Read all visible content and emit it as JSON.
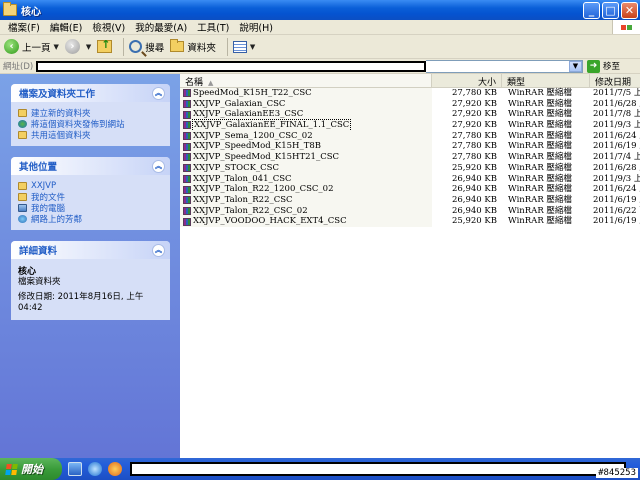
{
  "window": {
    "title": "核心"
  },
  "menu": {
    "items": [
      "檔案(F)",
      "編輯(E)",
      "檢視(V)",
      "我的最愛(A)",
      "工具(T)",
      "說明(H)"
    ]
  },
  "toolbar": {
    "back": "上一頁",
    "search": "搜尋",
    "folders": "資料夾"
  },
  "address": {
    "label": "網址(D)",
    "go": "移至"
  },
  "left": {
    "tasks": {
      "title": "檔案及資料夾工作",
      "links": [
        "建立新的資料夾",
        "將這個資料夾發佈到網站",
        "共用這個資料夾"
      ]
    },
    "places": {
      "title": "其他位置",
      "links": [
        "XXJVP",
        "我的文件",
        "我的電腦",
        "網路上的芳鄰"
      ]
    },
    "details": {
      "title": "詳細資料",
      "name": "核心",
      "kind": "檔案資料夾",
      "modified": "修改日期: 2011年8月16日, 上午 04:42"
    }
  },
  "list": {
    "columns": {
      "name": "名稱",
      "size": "大小",
      "type": "類型",
      "date": "修改日期"
    },
    "files": [
      {
        "name": "SpeedMod_K15H_T22_CSC",
        "size": "27,780 KB",
        "type": "WinRAR 壓縮檔",
        "date": "2011/7/5 上午"
      },
      {
        "name": "XXJVP_Galaxian_CSC",
        "size": "27,920 KB",
        "type": "WinRAR 壓縮檔",
        "date": "2011/6/28 上午"
      },
      {
        "name": "XXJVP_GalaxianEE3_CSC",
        "size": "27,920 KB",
        "type": "WinRAR 壓縮檔",
        "date": "2011/7/8 上午"
      },
      {
        "name": "XXJVP_GalaxianEE_FINAL_1.1_CSC",
        "size": "27,920 KB",
        "type": "WinRAR 壓縮檔",
        "date": "2011/9/3 上午"
      },
      {
        "name": "XXJVP_Sema_1200_CSC_02",
        "size": "27,780 KB",
        "type": "WinRAR 壓縮檔",
        "date": "2011/6/24 上午"
      },
      {
        "name": "XXJVP_SpeedMod_K15H_T8B",
        "size": "27,780 KB",
        "type": "WinRAR 壓縮檔",
        "date": "2011/6/19 上午"
      },
      {
        "name": "XXJVP_SpeedMod_K15HT21_CSC",
        "size": "27,780 KB",
        "type": "WinRAR 壓縮檔",
        "date": "2011/7/4 上午"
      },
      {
        "name": "XXJVP_STOCK_CSC",
        "size": "25,920 KB",
        "type": "WinRAR 壓縮檔",
        "date": "2011/6/28 上午"
      },
      {
        "name": "XXJVP_Talon_041_CSC",
        "size": "26,940 KB",
        "type": "WinRAR 壓縮檔",
        "date": "2011/9/3 上午"
      },
      {
        "name": "XXJVP_Talon_R22_1200_CSC_02",
        "size": "26,940 KB",
        "type": "WinRAR 壓縮檔",
        "date": "2011/6/24 上午"
      },
      {
        "name": "XXJVP_Talon_R22_CSC",
        "size": "26,940 KB",
        "type": "WinRAR 壓縮檔",
        "date": "2011/6/19 上午"
      },
      {
        "name": "XXJVP_Talon_R22_CSC_02",
        "size": "26,940 KB",
        "type": "WinRAR 壓縮檔",
        "date": "2011/6/22 下午"
      },
      {
        "name": "XXJVP_VOODOO_HACK_EXT4_CSC",
        "size": "25,920 KB",
        "type": "WinRAR 壓縮檔",
        "date": "2011/6/19 上午"
      }
    ],
    "selected_index": 3
  },
  "taskbar": {
    "start": "開始"
  },
  "watermark": "#845253"
}
